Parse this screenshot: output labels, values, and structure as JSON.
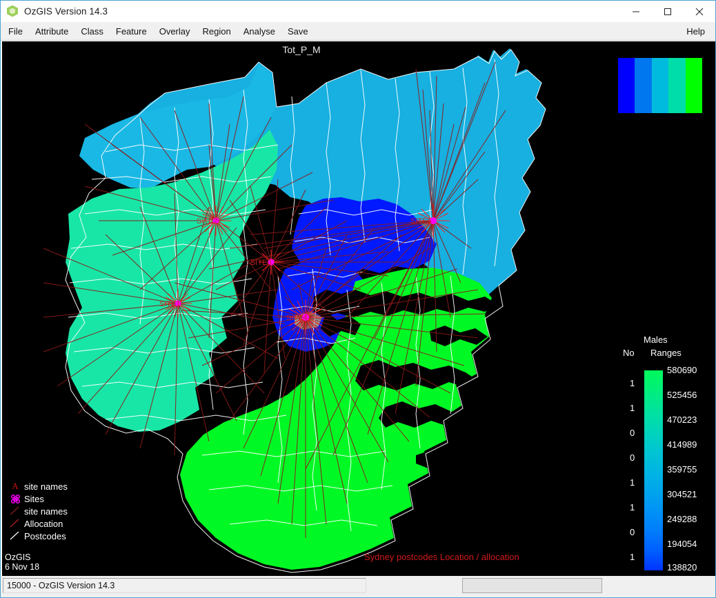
{
  "window": {
    "title": "OzGIS Version 14.3",
    "icon": "ozgis-hex-icon",
    "minimize_label": "–",
    "maximize_label": "□",
    "close_label": "✕"
  },
  "menu": {
    "items": [
      {
        "label": "File"
      },
      {
        "label": "Attribute"
      },
      {
        "label": "Class"
      },
      {
        "label": "Feature"
      },
      {
        "label": "Overlay"
      },
      {
        "label": "Region"
      },
      {
        "label": "Analyse"
      },
      {
        "label": "Save"
      }
    ],
    "help_label": "Help"
  },
  "map": {
    "title": "Tot_P_M",
    "caption": "Sydney postcodes Location / allocation",
    "stamp": "OzGIS\n6 Nov 18",
    "background_color": "#000000",
    "site_labels": [
      "SITE1",
      "SITE2",
      "SITE3",
      "SITE4",
      "SITE5"
    ],
    "class_swatches": [
      "#0000ff",
      "#0077ee",
      "#00bbdd",
      "#00ddaa",
      "#00ff00"
    ],
    "region_colors": {
      "dark_blue": "#0019ff",
      "mid_blue": "#1b7fe8",
      "cyan_blue": "#17b6e2",
      "teal_green": "#18e8a8",
      "bright_green": "#00f924",
      "boundary": "#ffffff",
      "coast": "#000000",
      "grey_patch": "#9a9a9a",
      "allocation_line": "#8b1a1a",
      "site_line": "#ff2020",
      "site_marker": "#ff00ff"
    }
  },
  "feature_legend": {
    "items": [
      {
        "symbol": "letter-a-red",
        "label": "site names"
      },
      {
        "symbol": "sites-marker",
        "label": "Sites"
      },
      {
        "symbol": "line-darkred",
        "label": "site names"
      },
      {
        "symbol": "line-red",
        "label": "Allocation"
      },
      {
        "symbol": "line-white",
        "label": "Postcodes"
      }
    ]
  },
  "value_legend": {
    "title": "Males",
    "col_no": "No",
    "col_ranges": "Ranges",
    "ranges": [
      "580690",
      "525456",
      "470223",
      "414989",
      "359755",
      "304521",
      "249288",
      "194054",
      "138820"
    ],
    "counts": [
      "1",
      "1",
      "0",
      "0",
      "1",
      "1",
      "0",
      "1"
    ],
    "bar_top_color": "#00f95a",
    "bar_bottom_color": "#0033ff"
  },
  "status_bar": {
    "main_text": "15000 - OzGIS Version 14.3",
    "aux_text": ""
  }
}
